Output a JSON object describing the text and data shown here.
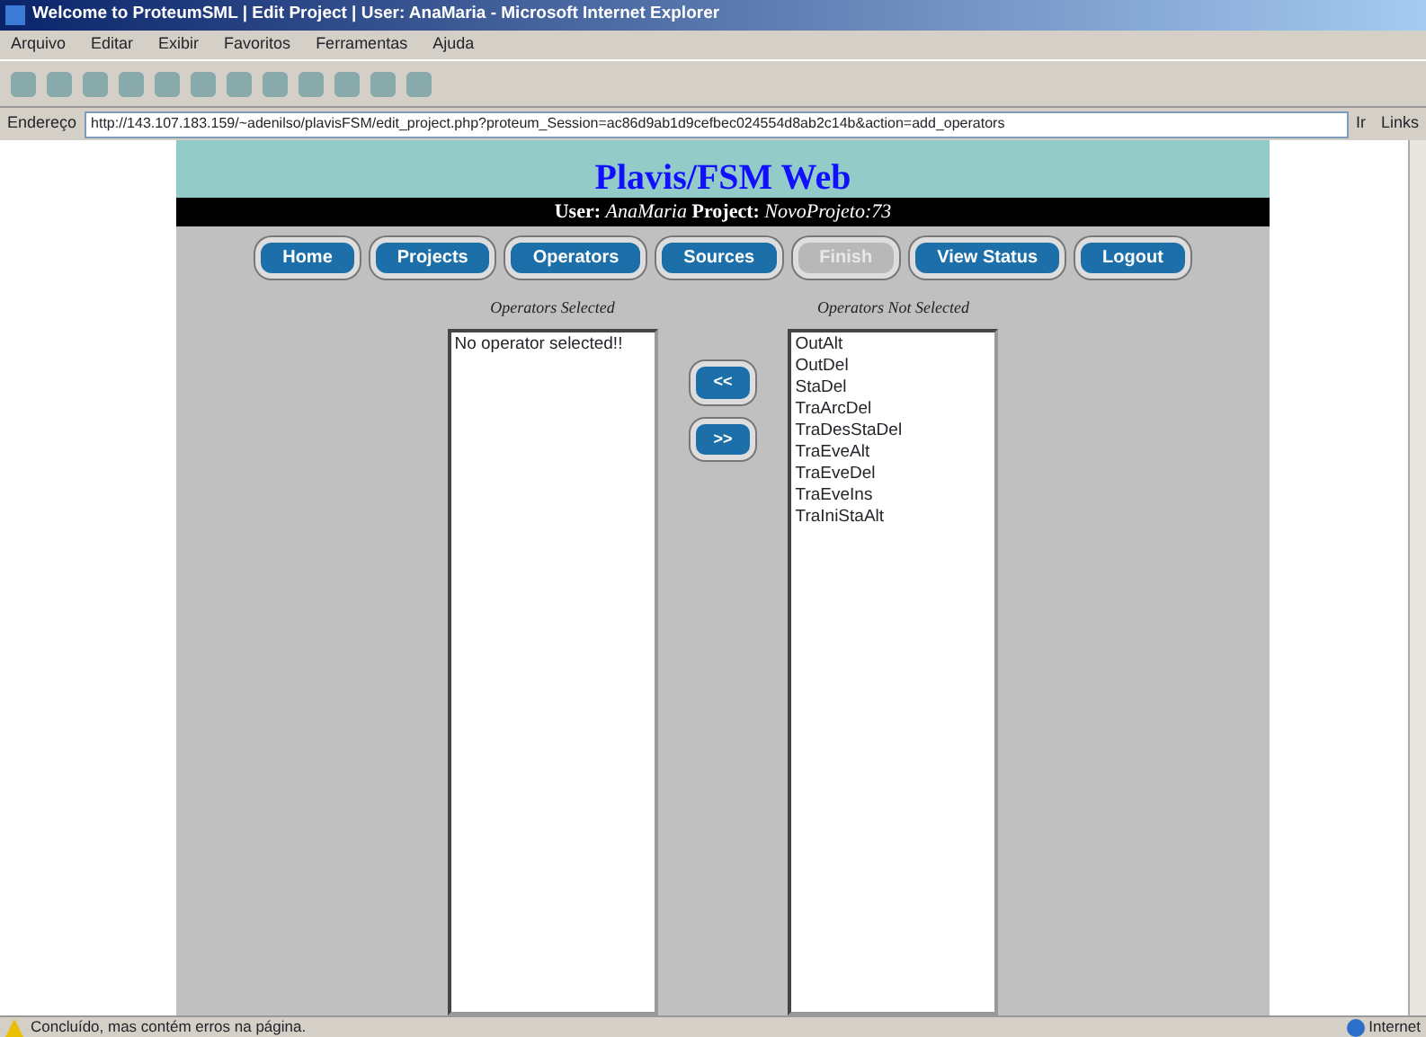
{
  "window": {
    "title": "Welcome to ProteumSML | Edit Project | User: AnaMaria - Microsoft Internet Explorer"
  },
  "menu": [
    "Arquivo",
    "Editar",
    "Exibir",
    "Favoritos",
    "Ferramentas",
    "Ajuda"
  ],
  "address_bar": {
    "label": "Endereço",
    "url": "http://143.107.183.159/~adenilso/plavisFSM/edit_project.php?proteum_Session=ac86d9ab1d9cefbec024554d8ab2c14b&action=add_operators",
    "go": "Ir",
    "links": "Links"
  },
  "page": {
    "heading": "Plavis/FSM Web",
    "user_label": "User:",
    "user": "AnaMaria",
    "project_label": "Project:",
    "project": "NovoProjeto:73",
    "nav": [
      {
        "label": "Home",
        "disabled": false
      },
      {
        "label": "Projects",
        "disabled": false
      },
      {
        "label": "Operators",
        "disabled": false
      },
      {
        "label": "Sources",
        "disabled": false
      },
      {
        "label": "Finish",
        "disabled": true
      },
      {
        "label": "View Status",
        "disabled": false
      },
      {
        "label": "Logout",
        "disabled": false
      }
    ],
    "selected_list": {
      "caption": "Operators Selected",
      "items": [
        "No operator selected!!"
      ]
    },
    "move_buttons": [
      "<<",
      ">>"
    ],
    "not_selected_list": {
      "caption": "Operators Not Selected",
      "items": [
        "OutAlt",
        "OutDel",
        "StaDel",
        "TraArcDel",
        "TraDesStaDel",
        "TraEveAlt",
        "TraEveDel",
        "TraEveIns",
        "TraIniStaAlt"
      ]
    }
  },
  "status_bar": {
    "message": "Concluído, mas contém erros na página.",
    "zone": "Internet"
  }
}
